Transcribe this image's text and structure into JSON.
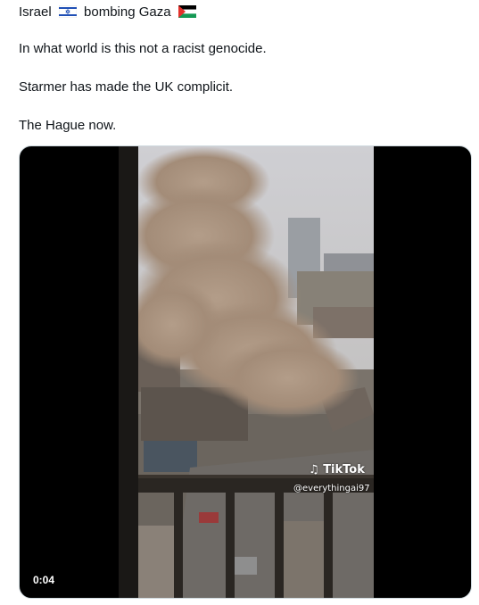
{
  "post": {
    "line1_pre": "Israel",
    "line1_post": "bombing Gaza",
    "line2": "In what world is this not a racist genocide.",
    "line3": "Starmer has made the UK complicit.",
    "line4": "The Hague now.",
    "flag1_icon": "israel-flag-icon",
    "flag2_icon": "palestine-flag-icon"
  },
  "video": {
    "watermark_brand": "TikTok",
    "watermark_handle": "@everythingai97",
    "duration": "0:04",
    "tiktok_icon": "tiktok-logo-icon"
  }
}
